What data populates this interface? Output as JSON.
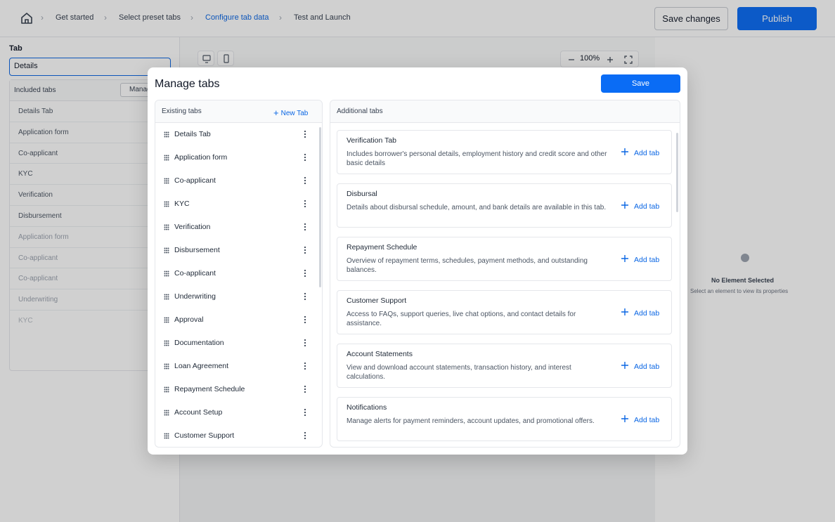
{
  "breadcrumb": {
    "items": [
      "Get started",
      "Select preset tabs",
      "Configure tab data",
      "Test and Launch"
    ],
    "active_index": 2
  },
  "header": {
    "save_changes_label": "Save changes",
    "publish_label": "Publish"
  },
  "left_panel": {
    "tab_label": "Tab",
    "tab_select_value": "Details",
    "included_title": "Included tabs",
    "manage_label": "Manage",
    "items": [
      "Details Tab",
      "Application form",
      "Co-applicant",
      "KYC",
      "Verification",
      "Disbursement",
      "Application form",
      "Co-applicant",
      "Co-applicant",
      "Underwriting",
      "KYC"
    ]
  },
  "canvas": {
    "zoom": "100%"
  },
  "right_panel": {
    "empty_title": "No Element Selected",
    "empty_subtitle": "Select an element to view its properties"
  },
  "modal": {
    "title": "Manage tabs",
    "save_label": "Save",
    "existing": {
      "title": "Existing tabs",
      "new_tab_label": "New Tab",
      "items": [
        "Details Tab",
        "Application form",
        "Co-applicant",
        "KYC",
        "Verification",
        "Disbursement",
        "Co-applicant",
        "Underwriting",
        "Approval",
        "Documentation",
        "Loan Agreement",
        "Repayment Schedule",
        "Account Setup",
        "Customer Support"
      ]
    },
    "additional": {
      "title": "Additional tabs",
      "add_label": "Add tab",
      "cards": [
        {
          "title": "Verification Tab",
          "desc": "Includes borrower's personal details, employment history and credit score and other basic details"
        },
        {
          "title": "Disbursal",
          "desc": "Details about disbursal schedule, amount, and bank details are available in this tab."
        },
        {
          "title": "Repayment Schedule",
          "desc": "Overview of repayment terms, schedules, payment methods, and outstanding balances."
        },
        {
          "title": "Customer Support",
          "desc": "Access to FAQs, support queries, live chat options, and contact details for assistance."
        },
        {
          "title": "Account Statements",
          "desc": "View and download account statements, transaction history, and interest calculations."
        },
        {
          "title": "Notifications",
          "desc": "Manage alerts for payment reminders, account updates, and promotional offers."
        }
      ]
    }
  },
  "colors": {
    "accent": "#0a6cf5",
    "link": "#0a66e4"
  }
}
